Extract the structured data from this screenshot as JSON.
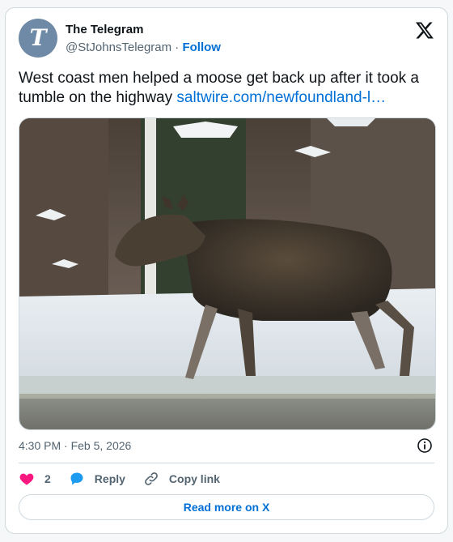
{
  "account": {
    "name": "The Telegram",
    "handle": "@StJohnsTelegram",
    "separator": "·",
    "follow_label": "Follow",
    "avatar_glyph": "T",
    "avatar_color": "#6f8aa6"
  },
  "tweet": {
    "text": "West coast men helped a moose get back up after it took a tumble on the highway",
    "link_text": "saltwire.com/newfoundland-l…",
    "media_icon": "photo-moose-on-snowy-roadside",
    "timestamp": "4:30 PM · Feb 5, 2026"
  },
  "actions": {
    "like_count": "2",
    "reply_label": "Reply",
    "copy_link_label": "Copy link",
    "read_more_label": "Read more on X"
  },
  "colors": {
    "link": "#006fd6",
    "like": "#f91880",
    "reply": "#1d9bf0",
    "border": "#cfd9de"
  },
  "icons": [
    "x-logo-icon",
    "info-icon",
    "heart-icon",
    "reply-bubble-icon",
    "link-icon"
  ]
}
